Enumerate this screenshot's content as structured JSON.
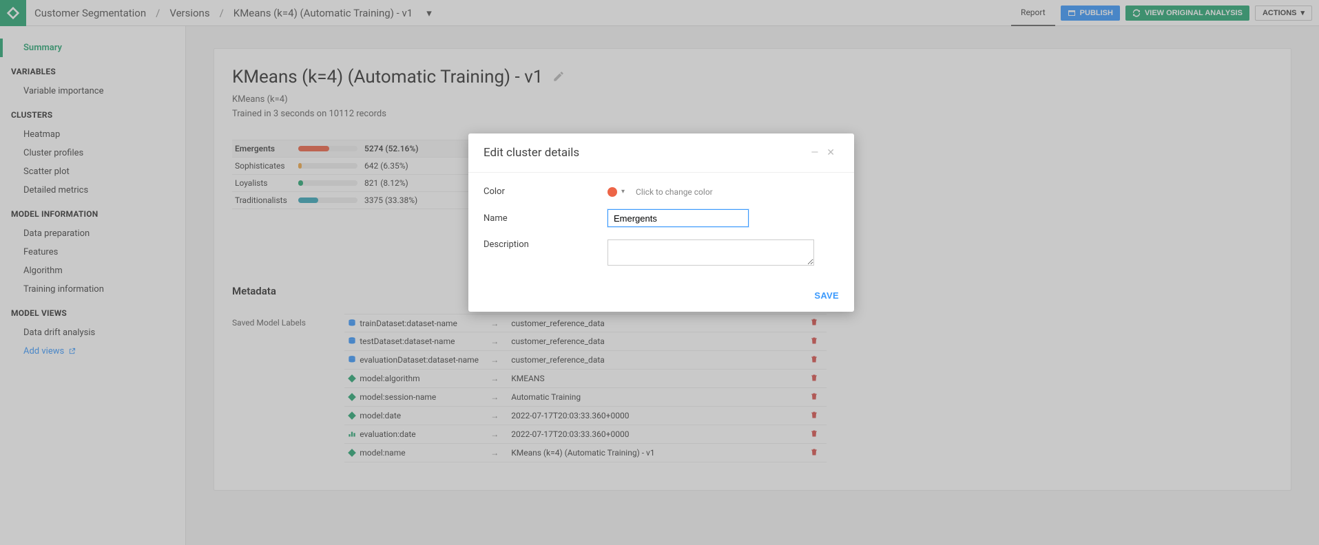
{
  "breadcrumbs": {
    "a": "Customer Segmentation",
    "b": "Versions",
    "c": "KMeans (k=4) (Automatic Training) - v1"
  },
  "topright": {
    "report": "Report",
    "publish": "PUBLISH",
    "view_original": "VIEW ORIGINAL ANALYSIS",
    "actions": "ACTIONS"
  },
  "sidebar": {
    "summary": "Summary",
    "variables_h": "VARIABLES",
    "variable_importance": "Variable importance",
    "clusters_h": "CLUSTERS",
    "heatmap": "Heatmap",
    "cluster_profiles": "Cluster profiles",
    "scatter_plot": "Scatter plot",
    "detailed_metrics": "Detailed metrics",
    "model_info_h": "MODEL INFORMATION",
    "data_prep": "Data preparation",
    "features": "Features",
    "algorithm": "Algorithm",
    "training_info": "Training information",
    "model_views_h": "MODEL VIEWS",
    "data_drift": "Data drift analysis",
    "add_views": "Add views"
  },
  "page": {
    "title": "KMeans (k=4) (Automatic Training) - v1",
    "subtitle": "KMeans (k=4)",
    "trained": "Trained in 3 seconds on 10112 records"
  },
  "clusters": [
    {
      "name": "Emergents",
      "count": "5274 (52.16%)",
      "pct": 52.16,
      "color": "#ed6547",
      "active": true
    },
    {
      "name": "Sophisticates",
      "count": "642 (6.35%)",
      "pct": 6.35,
      "color": "#f0a94a"
    },
    {
      "name": "Loyalists",
      "count": "821 (8.12%)",
      "pct": 8.12,
      "color": "#2aa876"
    },
    {
      "name": "Traditionalists",
      "count": "3375 (33.38%)",
      "pct": 33.38,
      "color": "#3aa6b9"
    }
  ],
  "metadata": {
    "title": "Metadata",
    "saved_labels": "Saved Model Labels",
    "rows": [
      {
        "icon": "db",
        "k": "trainDataset:dataset-name",
        "v": "customer_reference_data"
      },
      {
        "icon": "db",
        "k": "testDataset:dataset-name",
        "v": "customer_reference_data"
      },
      {
        "icon": "db",
        "k": "evaluationDataset:dataset-name",
        "v": "customer_reference_data"
      },
      {
        "icon": "model",
        "k": "model:algorithm",
        "v": "KMEANS"
      },
      {
        "icon": "model",
        "k": "model:session-name",
        "v": "Automatic Training"
      },
      {
        "icon": "model",
        "k": "model:date",
        "v": "2022-07-17T20:03:33.360+0000"
      },
      {
        "icon": "eval",
        "k": "evaluation:date",
        "v": "2022-07-17T20:03:33.360+0000"
      },
      {
        "icon": "model",
        "k": "model:name",
        "v": "KMeans (k=4) (Automatic Training) - v1"
      }
    ]
  },
  "modal": {
    "title": "Edit cluster details",
    "color_label": "Color",
    "color_hint": "Click to change color",
    "color_value": "#ed6547",
    "name_label": "Name",
    "name_value": "Emergents",
    "desc_label": "Description",
    "desc_value": "",
    "save": "SAVE"
  }
}
